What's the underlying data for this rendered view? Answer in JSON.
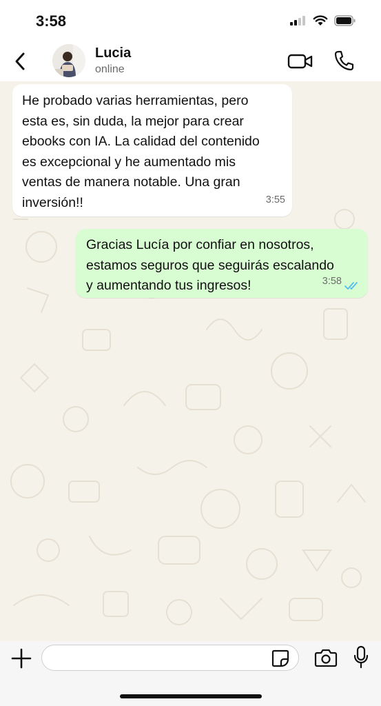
{
  "status_bar": {
    "time": "3:58"
  },
  "header": {
    "contact_name": "Lucia",
    "contact_status": "online"
  },
  "messages": [
    {
      "direction": "incoming",
      "text": "He probado varias herramientas, pero\nesta es, sin duda, la mejor para crear\nebooks con IA. La calidad del contenido\nes excepcional y he aumentado mis\nventas de manera notable. Una gran\ninversión!!",
      "time": "3:55"
    },
    {
      "direction": "outgoing",
      "text": "Gracias Lucía por confiar en nosotros,\nestamos seguros que seguirás escalando\ny aumentando tus ingresos!",
      "time": "3:58",
      "status": "read"
    }
  ],
  "input": {
    "placeholder": ""
  },
  "colors": {
    "incoming_bubble": "#ffffff",
    "outgoing_bubble": "#d9fdd3",
    "chat_background": "#f5f2ea",
    "read_ticks": "#53bdeb"
  },
  "icons": {
    "back": "chevron-left-icon",
    "video": "video-camera-icon",
    "call": "phone-icon",
    "plus": "plus-icon",
    "sticker": "sticker-icon",
    "camera": "camera-icon",
    "mic": "microphone-icon"
  }
}
